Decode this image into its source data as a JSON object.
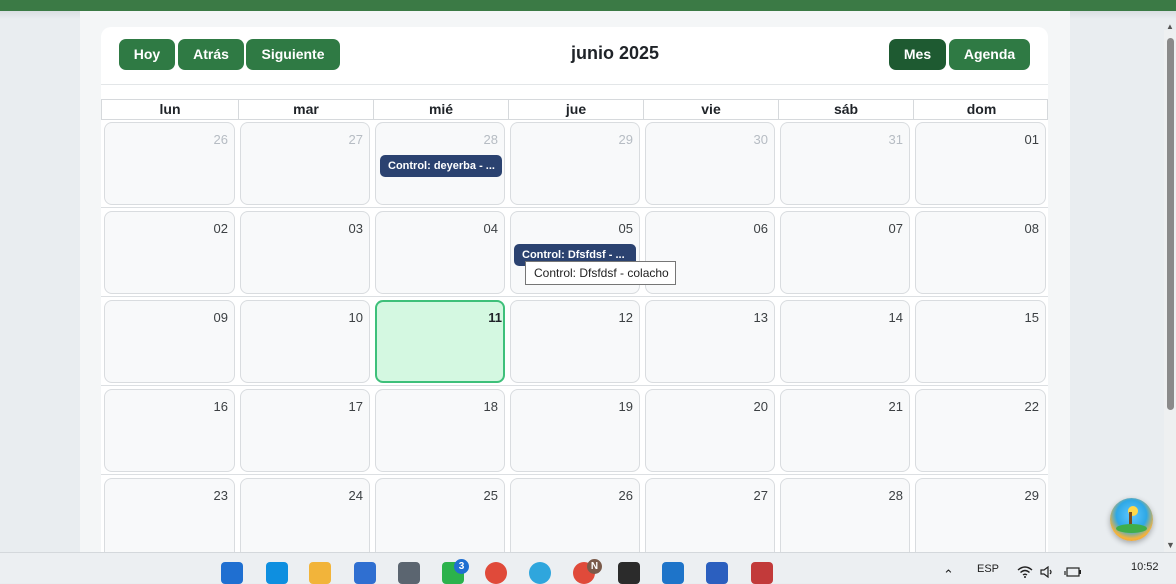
{
  "toolbar": {
    "today_label": "Hoy",
    "back_label": "Atrás",
    "next_label": "Siguiente",
    "title": "junio 2025",
    "month_label": "Mes",
    "agenda_label": "Agenda",
    "active_view": "Mes"
  },
  "weekdays": [
    "lun",
    "mar",
    "mié",
    "jue",
    "vie",
    "sáb",
    "dom"
  ],
  "weeks": [
    [
      "26",
      "27",
      "28",
      "29",
      "30",
      "31",
      "01"
    ],
    [
      "02",
      "03",
      "04",
      "05",
      "06",
      "07",
      "08"
    ],
    [
      "09",
      "10",
      "11",
      "12",
      "13",
      "14",
      "15"
    ],
    [
      "16",
      "17",
      "18",
      "19",
      "20",
      "21",
      "22"
    ],
    [
      "23",
      "24",
      "25",
      "26",
      "27",
      "28",
      "29"
    ]
  ],
  "today": "11",
  "events": [
    {
      "label": "Control: deyerba - ..."
    },
    {
      "label": "Control: Dfsfdsf - ..."
    }
  ],
  "tooltip": "Control: Dfsfdsf - colacho",
  "colors": {
    "header_green": "#3b7a45",
    "button_green": "#2f7a44",
    "button_active": "#1e5a31",
    "event_blue": "#2b4270",
    "today_bg": "#d4f8e1",
    "today_border": "#3ec07a"
  },
  "taskbar": {
    "apps": [
      "windows-start-icon",
      "edge-copilot-icon",
      "file-explorer-icon",
      "microsoft-store-icon",
      "calculator-icon",
      "whatsapp-icon",
      "chrome-icon",
      "edge-icon",
      "chrome-profile-icon",
      "terminal-icon",
      "vscode-icon",
      "word-icon",
      "snipping-tool-icon"
    ],
    "whatsapp_badge": "3",
    "chrome_profile_badge": "N",
    "language": "ESP",
    "time": "10:52"
  }
}
